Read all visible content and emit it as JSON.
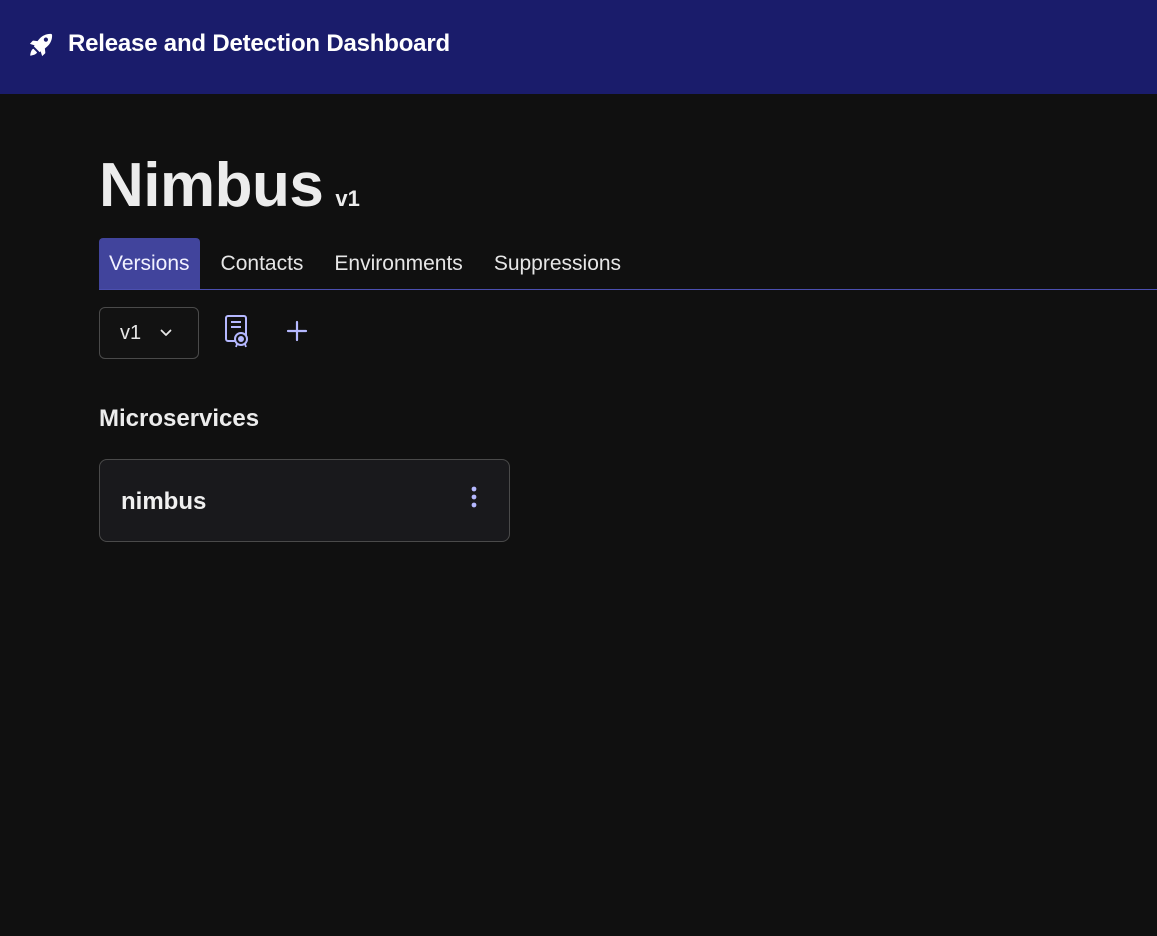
{
  "header": {
    "app_title": "Release and Detection Dashboard",
    "logo_icon": "rocket-icon",
    "background": "#1a1c6b"
  },
  "page": {
    "title": "Nimbus",
    "version_badge": "v1"
  },
  "tabs": [
    {
      "label": "Versions",
      "active": true
    },
    {
      "label": "Contacts",
      "active": false
    },
    {
      "label": "Environments",
      "active": false
    },
    {
      "label": "Suppressions",
      "active": false
    }
  ],
  "toolbar": {
    "version_select_value": "v1",
    "certificate_icon": "certificate-icon",
    "add_icon": "plus-icon"
  },
  "microservices": {
    "heading": "Microservices",
    "items": [
      {
        "name": "nimbus",
        "menu_icon": "more-vertical-icon"
      }
    ]
  },
  "colors": {
    "accent": "#41449c",
    "icon_accent": "#b5b8ff",
    "background": "#101010"
  }
}
